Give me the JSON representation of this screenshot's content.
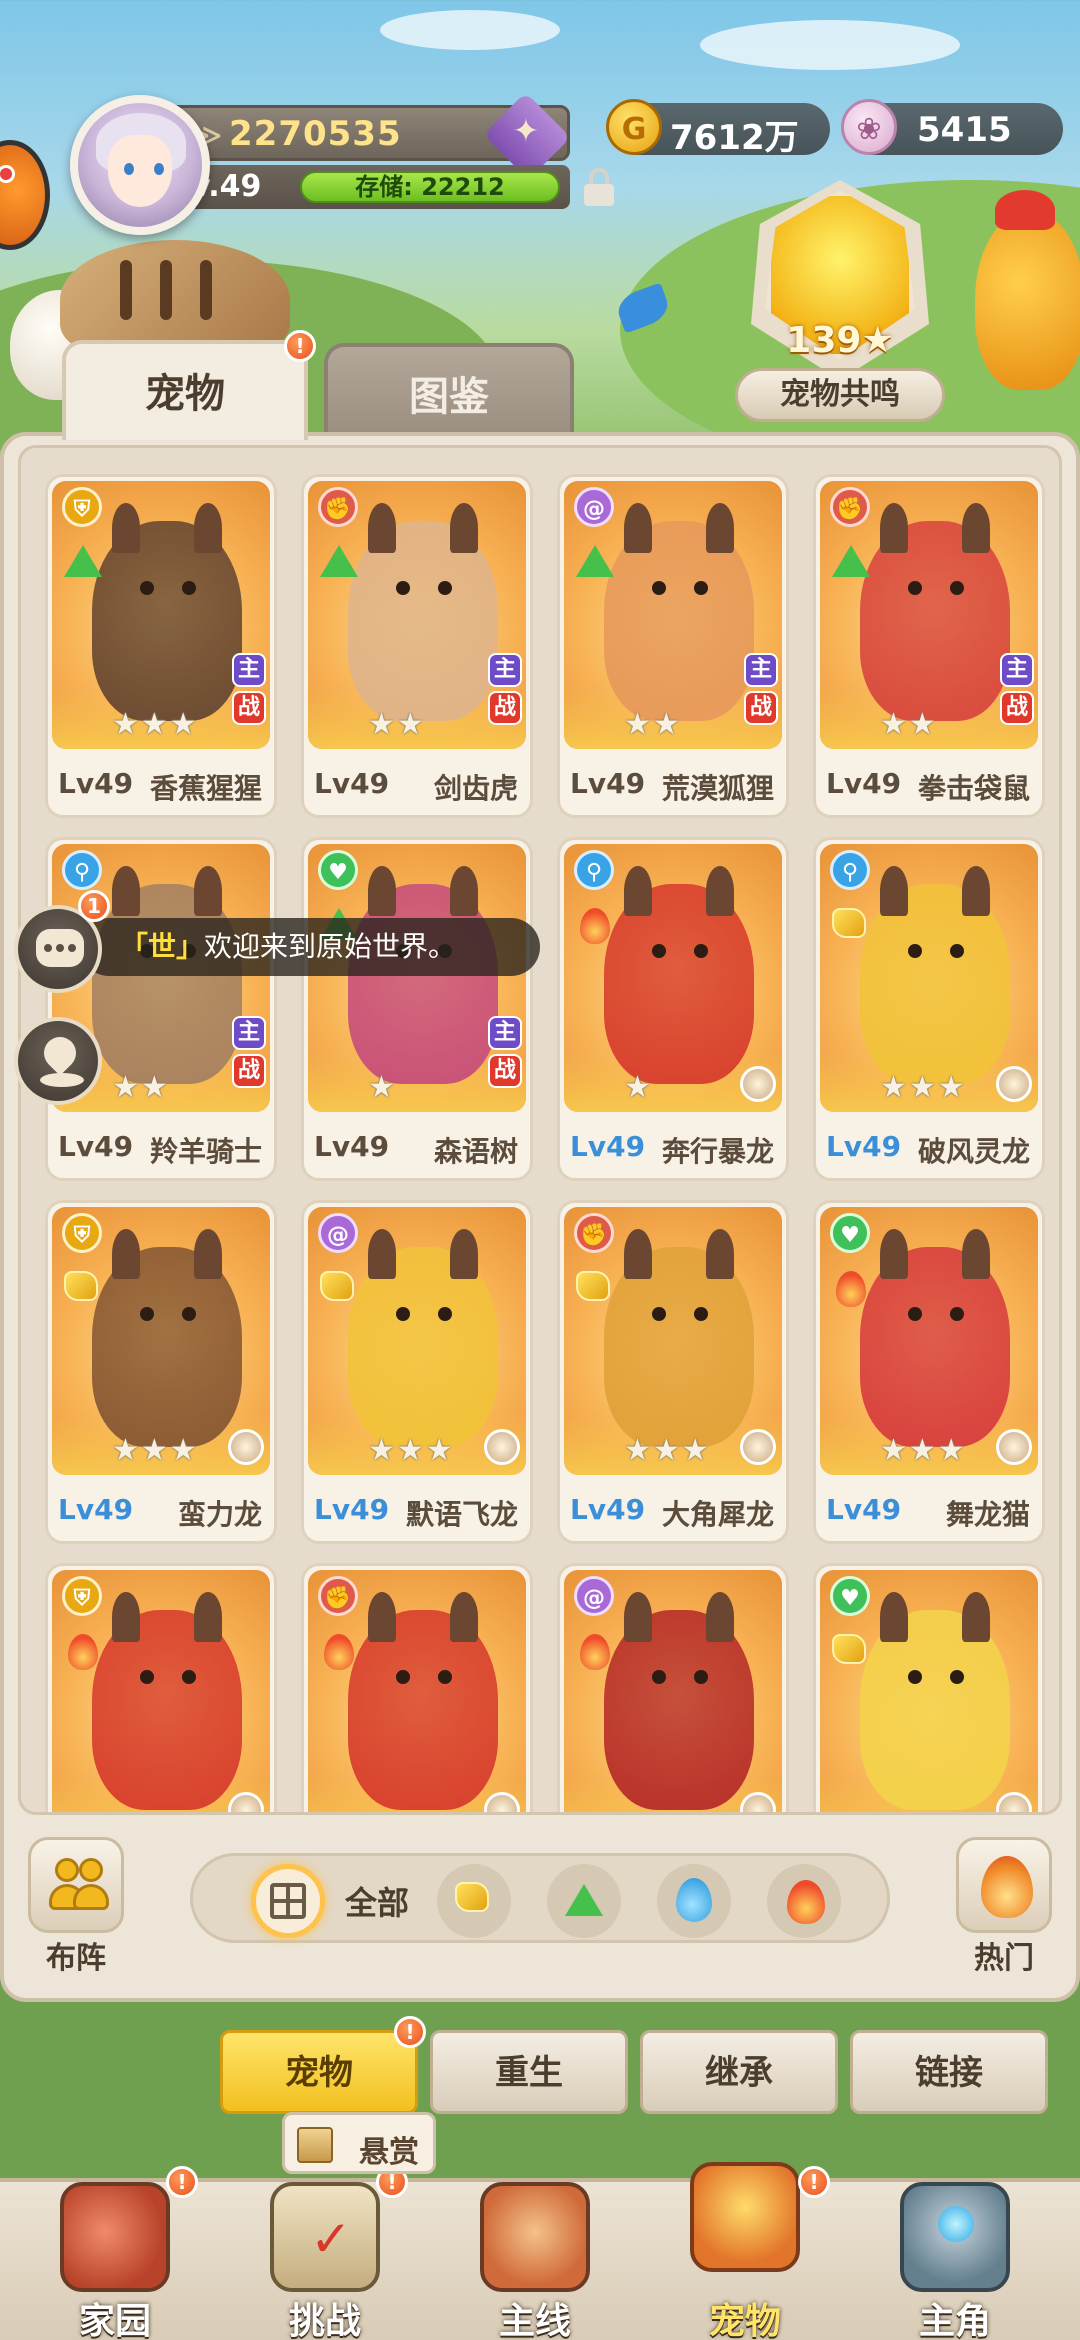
{
  "header": {
    "power": "2270535",
    "level": "Lv.49",
    "storage": "存储: 22212",
    "gold": "7612万",
    "shells": "5415",
    "resonance_count": "139",
    "resonance_label": "宠物共鸣"
  },
  "tabs": {
    "pets": "宠物",
    "codex": "图鉴"
  },
  "chat": {
    "unread": "1",
    "channel": "「世」",
    "message": "欢迎来到原始世界。"
  },
  "pets": [
    {
      "level": "Lv49",
      "name": "香蕉猩猩",
      "stars": "★★★",
      "element": "shield",
      "type": "grass",
      "main": true
    },
    {
      "level": "Lv49",
      "name": "剑齿虎",
      "stars": "★★",
      "element": "fist",
      "type": "grass",
      "main": true
    },
    {
      "level": "Lv49",
      "name": "荒漠狐狸",
      "stars": "★★",
      "element": "swirl",
      "type": "grass",
      "main": true
    },
    {
      "level": "Lv49",
      "name": "拳击袋鼠",
      "stars": "★★",
      "element": "fist",
      "type": "grass",
      "main": true
    },
    {
      "level": "Lv49",
      "name": "羚羊骑士",
      "stars": "★★",
      "element": "key",
      "type": "grass",
      "main": true
    },
    {
      "level": "Lv49",
      "name": "森语树",
      "stars": "★",
      "element": "heart",
      "type": "grass",
      "main": true
    },
    {
      "level": "Lv49",
      "name": "奔行暴龙",
      "stars": "★",
      "element": "key",
      "type": "fire",
      "main": false
    },
    {
      "level": "Lv49",
      "name": "破风灵龙",
      "stars": "★★★",
      "element": "key",
      "type": "rock",
      "main": false
    },
    {
      "level": "Lv49",
      "name": "蛮力龙",
      "stars": "★★★",
      "element": "shield",
      "type": "rock",
      "main": false
    },
    {
      "level": "Lv49",
      "name": "默语飞龙",
      "stars": "★★★",
      "element": "swirl",
      "type": "rock",
      "main": false
    },
    {
      "level": "Lv49",
      "name": "大角犀龙",
      "stars": "★★★",
      "element": "fist",
      "type": "rock",
      "main": false
    },
    {
      "level": "Lv49",
      "name": "舞龙猫",
      "stars": "★★★",
      "element": "heart",
      "type": "fire",
      "main": false
    },
    {
      "element": "shield",
      "type": "fire"
    },
    {
      "element": "fist",
      "type": "fire"
    },
    {
      "element": "swirl",
      "type": "fire"
    },
    {
      "element": "heart",
      "type": "rock"
    }
  ],
  "card_tags": {
    "main": "主",
    "war": "战"
  },
  "filter": {
    "formation": "布阵",
    "all": "全部",
    "hot": "热门"
  },
  "subtabs": {
    "pets": "宠物",
    "rebirth": "重生",
    "inherit": "继承",
    "link": "链接"
  },
  "bounty": "悬赏",
  "nav": {
    "home": "家园",
    "challenge": "挑战",
    "main_quest": "主线",
    "pets": "宠物",
    "hero": "主角"
  },
  "colors": {
    "accent": "#f2c01f",
    "badge": "#e8501f",
    "level_blue": "#3b8fd8"
  }
}
